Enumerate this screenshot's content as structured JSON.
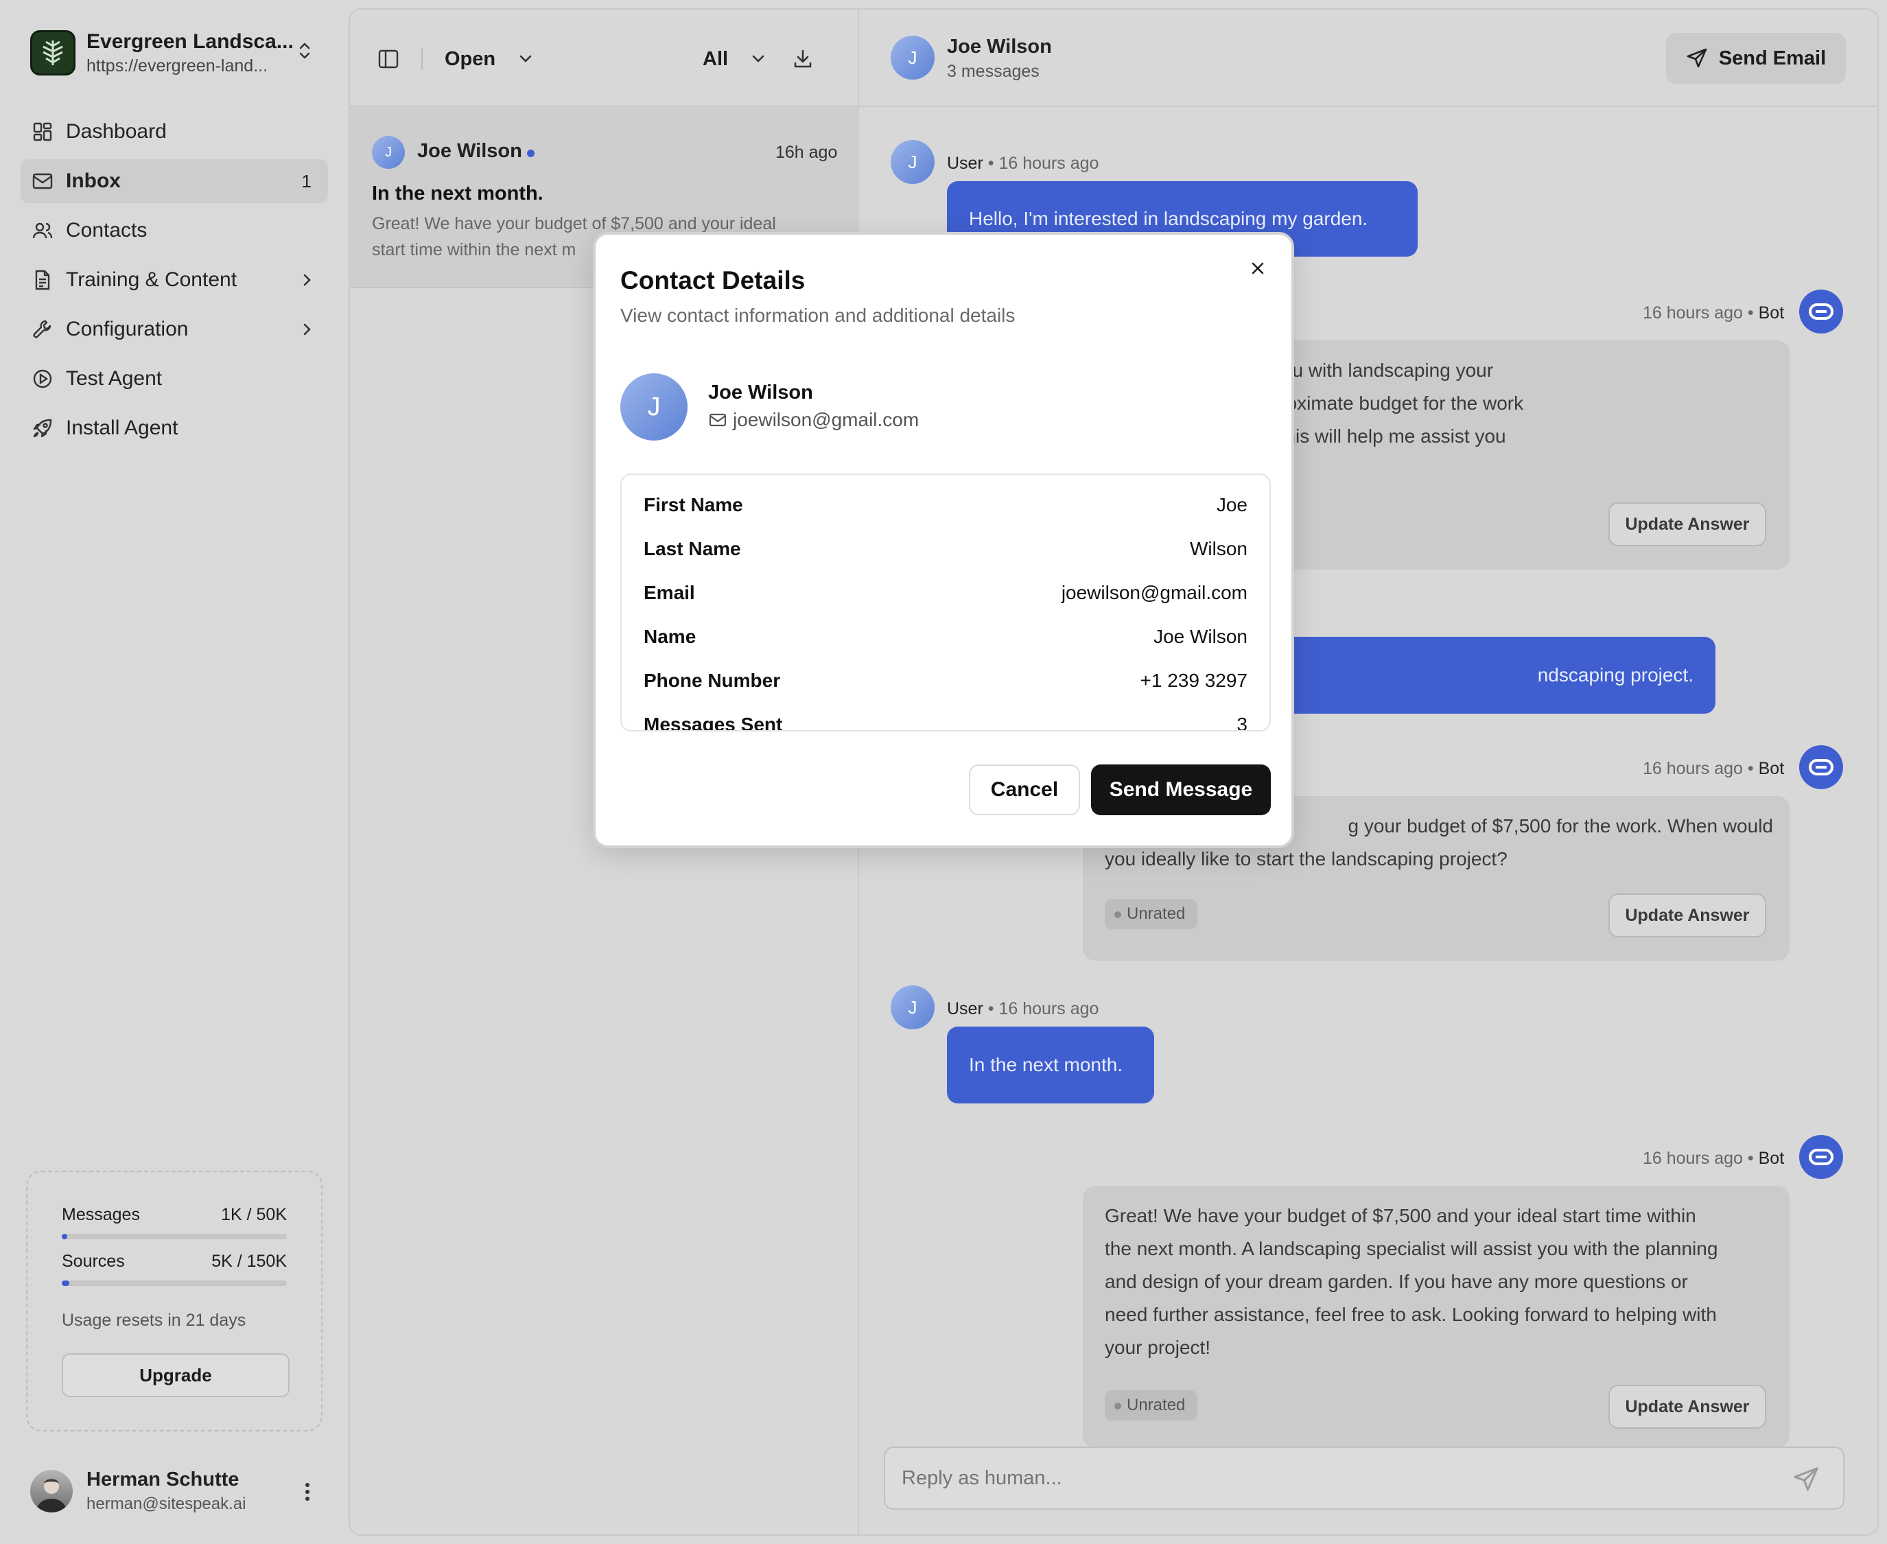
{
  "org": {
    "name": "Evergreen Landsca...",
    "url": "https://evergreen-land..."
  },
  "nav": [
    {
      "label": "Dashboard",
      "icon": "dashboard-icon"
    },
    {
      "label": "Inbox",
      "icon": "inbox-icon",
      "badge": "1",
      "active": true
    },
    {
      "label": "Contacts",
      "icon": "contacts-icon"
    },
    {
      "label": "Training & Content",
      "icon": "document-icon",
      "chevron": true
    },
    {
      "label": "Configuration",
      "icon": "wrench-icon",
      "chevron": true
    },
    {
      "label": "Test Agent",
      "icon": "play-circle-icon"
    },
    {
      "label": "Install Agent",
      "icon": "rocket-icon"
    }
  ],
  "usage": {
    "messages": {
      "label": "Messages",
      "value": "1K / 50K",
      "fraction": 0.02
    },
    "sources": {
      "label": "Sources",
      "value": "5K / 150K",
      "fraction": 0.033
    },
    "note": "Usage resets in 21 days",
    "upgrade_label": "Upgrade"
  },
  "user": {
    "name": "Herman Schutte",
    "email": "herman@sitespeak.ai"
  },
  "list": {
    "status_filter": "Open",
    "type_filter": "All",
    "conversation": {
      "initial": "J",
      "name": "Joe Wilson",
      "time": "16h ago",
      "subject": "In the next month.",
      "preview_1": "Great! We have your budget of $7,500 and your ideal",
      "preview_2": "start time within the next m"
    }
  },
  "chat": {
    "header": {
      "initial": "J",
      "name": "Joe Wilson",
      "count": "3 messages",
      "send_email_label": "Send Email"
    },
    "user_label": "User",
    "bot_label": "Bot",
    "time_label": "16 hours ago",
    "messages": [
      {
        "text": "Hello, I'm interested in landscaping my garden."
      },
      {
        "line_1": "eat project! To help you with landscaping your",
        "line_2": "ease share your approximate budget for the work",
        "line_3": " ideally like to start? This will help me assist you"
      },
      {
        "text": "ndscaping project."
      },
      {
        "line_1": "g your budget of $7,500 for the work. When would",
        "line_2": "you ideally like to start the landscaping project?"
      },
      {
        "text": "In the next month."
      },
      {
        "line_1": "Great! We have your budget of $7,500 and your ideal start time within",
        "line_2": "the next month. A landscaping specialist will assist you with the planning",
        "line_3": "and design of your dream garden. If you have any more questions or",
        "line_4": "need further assistance, feel free to ask. Looking forward to helping with",
        "line_5": "your project!"
      }
    ],
    "unrated_label": "Unrated",
    "update_answer_label": "Update Answer",
    "reply_placeholder": "Reply as human..."
  },
  "modal": {
    "title": "Contact Details",
    "subtitle": "View contact information and additional details",
    "contact": {
      "initial": "J",
      "name": "Joe Wilson",
      "email": "joewilson@gmail.com"
    },
    "fields": [
      {
        "label": "First Name",
        "value": "Joe"
      },
      {
        "label": "Last Name",
        "value": "Wilson"
      },
      {
        "label": "Email",
        "value": "joewilson@gmail.com"
      },
      {
        "label": "Name",
        "value": "Joe Wilson"
      },
      {
        "label": "Phone Number",
        "value": "+1 239 3297"
      },
      {
        "label": "Messages Sent",
        "value": "3"
      }
    ],
    "cancel_label": "Cancel",
    "send_label": "Send Message"
  },
  "colors": {
    "accent": "#3f5fd0",
    "primary_button": "#141414",
    "overlay": "#d9d9d9"
  }
}
